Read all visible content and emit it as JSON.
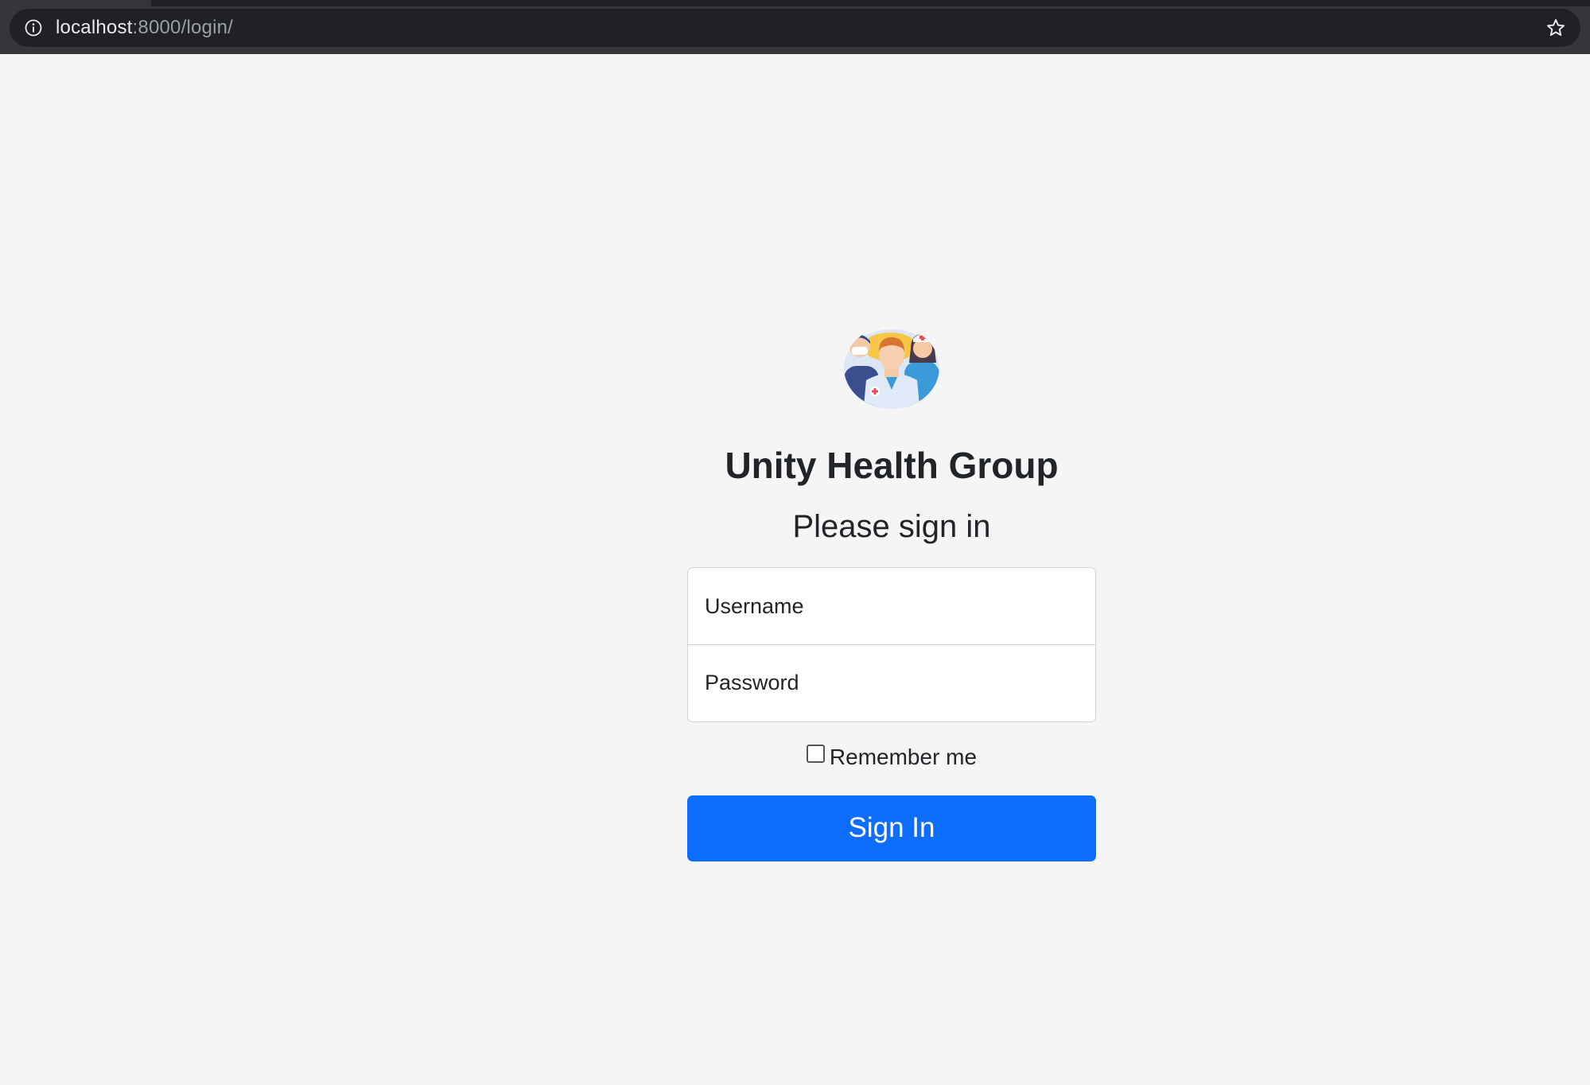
{
  "browser": {
    "url_host": "localhost",
    "url_path": ":8000/login/",
    "icons": {
      "site_info": "info-circle-icon",
      "bookmark": "star-icon"
    }
  },
  "login": {
    "logo_icon": "medical-team-logo",
    "brand": "Unity Health Group",
    "heading": "Please sign in",
    "username_placeholder": "Username",
    "username_value": "",
    "password_placeholder": "Password",
    "password_value": "",
    "remember_label": "Remember me",
    "remember_checked": false,
    "submit_label": "Sign In"
  },
  "colors": {
    "primary_button": "#0d6efd",
    "page_background": "#f5f5f5",
    "text": "#212529",
    "browser_toolbar": "#35363a",
    "omnibox": "#202124"
  }
}
